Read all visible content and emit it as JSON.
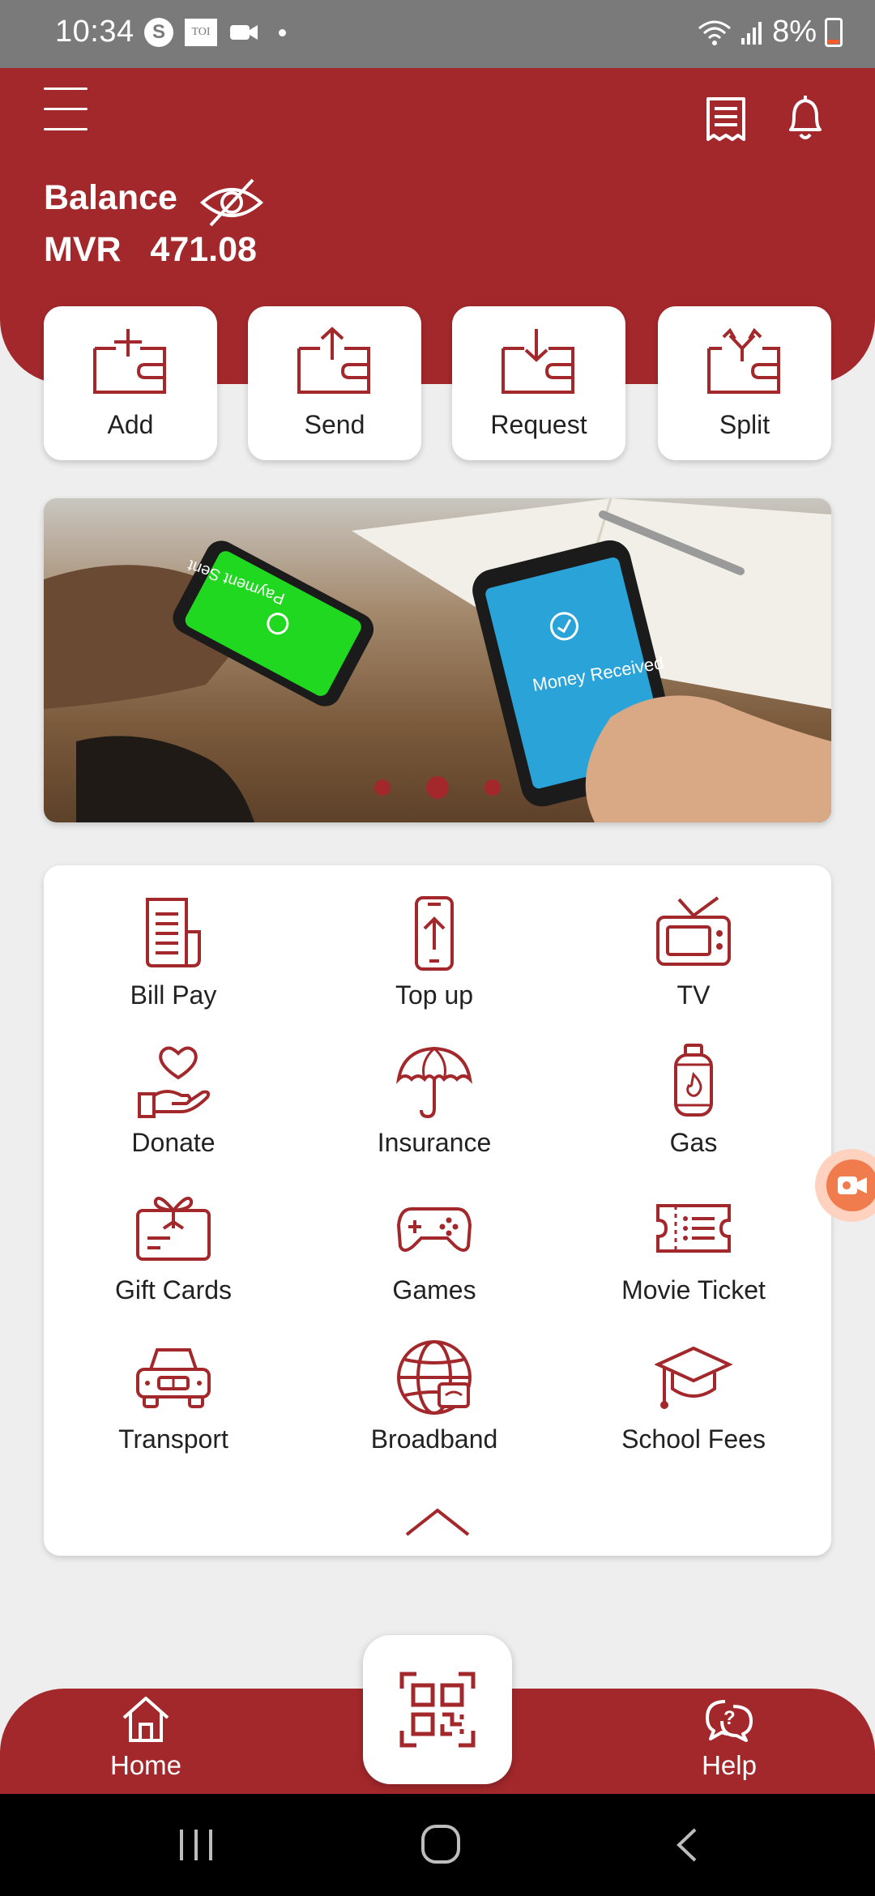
{
  "status_bar": {
    "time": "10:34",
    "battery": "8%",
    "skype_glyph": "S",
    "toi_glyph": "TOI"
  },
  "header": {
    "balance_label": "Balance",
    "currency": "MVR",
    "amount": "471.08"
  },
  "actions": [
    {
      "label": "Add",
      "icon": "wallet-add-icon"
    },
    {
      "label": "Send",
      "icon": "wallet-send-icon"
    },
    {
      "label": "Request",
      "icon": "wallet-request-icon"
    },
    {
      "label": "Split",
      "icon": "wallet-split-icon"
    }
  ],
  "banner": {
    "left_phone_text": "Payment Sent",
    "right_phone_text": "Money Received",
    "carousel_active_index": 1,
    "carousel_count": 3
  },
  "services": [
    {
      "label": "Bill Pay",
      "icon": "bill-icon"
    },
    {
      "label": "Top up",
      "icon": "phone-topup-icon"
    },
    {
      "label": "TV",
      "icon": "tv-icon"
    },
    {
      "label": "Donate",
      "icon": "donate-icon"
    },
    {
      "label": "Insurance",
      "icon": "umbrella-icon"
    },
    {
      "label": "Gas",
      "icon": "gas-cylinder-icon"
    },
    {
      "label": "Gift Cards",
      "icon": "gift-card-icon"
    },
    {
      "label": "Games",
      "icon": "gamepad-icon"
    },
    {
      "label": "Movie Ticket",
      "icon": "ticket-icon"
    },
    {
      "label": "Transport",
      "icon": "car-icon"
    },
    {
      "label": "Broadband",
      "icon": "globe-icon"
    },
    {
      "label": "School Fees",
      "icon": "graduation-cap-icon"
    }
  ],
  "bottom_nav": {
    "home_label": "Home",
    "help_label": "Help"
  },
  "colors": {
    "brand": "#a3282b",
    "background": "#eeeeee"
  }
}
